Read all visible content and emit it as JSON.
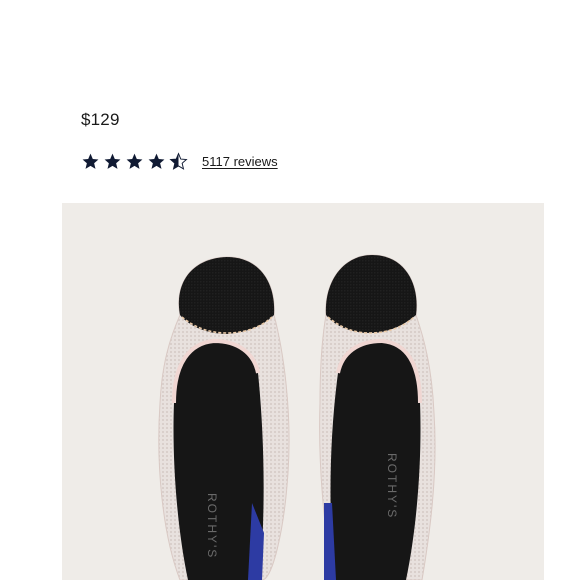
{
  "product": {
    "price": "$129",
    "rating": 4.5,
    "rating_max": 5,
    "reviews_label": "5117 reviews"
  },
  "image": {
    "brand_text": "ROTHY'S",
    "alt": "Product photo of flat shoes"
  },
  "colors": {
    "star": "#101a33",
    "image_bg": "#efece8",
    "toe_cap": "#151515",
    "knit": "#e6dedb",
    "insole": "#161616",
    "accent_blue": "#2d3ba3"
  }
}
